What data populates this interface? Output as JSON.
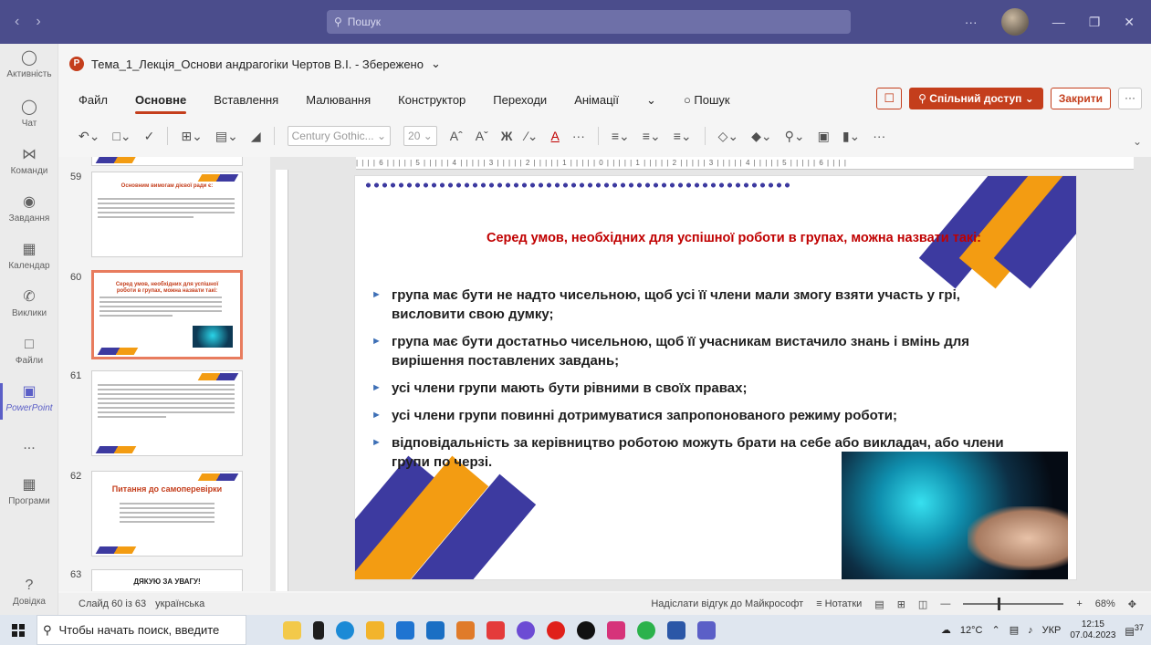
{
  "teams": {
    "search_placeholder": "Пошук",
    "rail": [
      {
        "label": "Активність",
        "icon": "bell-icon"
      },
      {
        "label": "Чат",
        "icon": "chat-icon"
      },
      {
        "label": "Команди",
        "icon": "teams-icon"
      },
      {
        "label": "Завдання",
        "icon": "assignments-icon"
      },
      {
        "label": "Календар",
        "icon": "calendar-icon"
      },
      {
        "label": "Виклики",
        "icon": "phone-icon"
      },
      {
        "label": "Файли",
        "icon": "file-icon"
      },
      {
        "label": "PowerPoint",
        "icon": "powerpoint-icon"
      },
      {
        "label": "...",
        "icon": "more-icon"
      },
      {
        "label": "Програми",
        "icon": "apps-icon"
      },
      {
        "label": "Довідка",
        "icon": "help-icon"
      }
    ]
  },
  "ppt": {
    "doc_title": "Тема_1_Лекція_Основи андрагогіки Чертов В.І. - Збережено",
    "tabs": [
      "Файл",
      "Основне",
      "Вставлення",
      "Малювання",
      "Конструктор",
      "Переходи",
      "Анімації",
      "Пошук"
    ],
    "share_label": "Спільний доступ",
    "close_label": "Закрити",
    "font_name": "Century Gothic...",
    "font_size": "20",
    "bold_glyph": "Ж"
  },
  "thumbnails": {
    "n59": "59",
    "n60": "60",
    "n61": "61",
    "n62": "62",
    "n63": "63",
    "t59": "Основним вимогам дієвої ради є:",
    "t60": "Серед умов, необхідних для успішної роботи в групах, можна назвати такі:",
    "t62": "Питання до самоперевірки",
    "t63": "ДЯКУЮ ЗА УВАГУ!"
  },
  "slide": {
    "heading": "Серед умов, необхідних для успішної роботи в групах, можна назвати такі:",
    "bullets": [
      "група має бути не надто чисельною, щоб усі її члени мали змогу взяти участь у грі, висловити свою думку;",
      "група має бути достатньо чисельною, щоб її учасникам вистачило знань і вмінь для вирішення поставлених завдань;",
      "усі члени групи мають бути рівними в своїх правах;",
      "усі члени групи повинні дотримуватися запропонованого режиму роботи;",
      "відповідальність за керівництво роботою можуть брати на себе або викладач, або члени групи по черзі."
    ],
    "ruler_text": "| | | | 6 | | | | | 5 | | | | | 4 | | | | | 3 | | | | | 2 | | | | | 1 | | | | | 0 | | | | | 1 | | | | | 2 | | | | | 3 | | | | | 4 | | | | | 5 | | | | | 6 | | | |"
  },
  "status": {
    "slide_count": "Слайд 60 із 63",
    "language": "українська",
    "feedback": "Надіслати відгук до Майкрософт",
    "notes": "Нотатки",
    "zoom": "68%"
  },
  "taskbar": {
    "search_placeholder": "Чтобы начать поиск, введите",
    "weather": "12°C",
    "lang": "УКР",
    "time": "12:15",
    "date": "07.04.2023",
    "notif_count": "37"
  },
  "colors": {
    "teams_bar": "#4b4d8c",
    "accent": "#c43e1c",
    "slide_heading": "#c00000",
    "stripe_orange": "#f39c12",
    "stripe_navy": "#3d3aa0"
  }
}
